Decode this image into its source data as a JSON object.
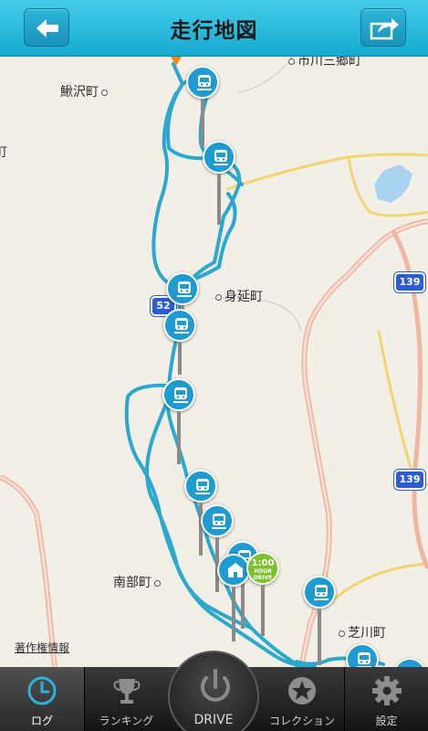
{
  "header": {
    "title": "走行地図"
  },
  "map": {
    "places": {
      "kajikazawa": "鰍沢町",
      "minobu": "身延町",
      "nanbu": "南部町",
      "shibakawa": "芝川町",
      "top_right": "市川三郷町",
      "left_edge": "町"
    },
    "route_shields": [
      "139",
      "139",
      "52"
    ],
    "copyright": "著作権情報",
    "goal_pin_text": [
      "1:00",
      "HOUR",
      "DRIVE"
    ]
  },
  "tabbar": {
    "tabs": [
      {
        "label": "ログ",
        "icon": "clock-icon",
        "active": true
      },
      {
        "label": "ランキング",
        "icon": "trophy-icon"
      },
      {
        "label": "DRIVE",
        "icon": "power-icon"
      },
      {
        "label": "コレクション",
        "icon": "star-icon"
      },
      {
        "label": "設定",
        "icon": "gear-icon"
      }
    ]
  },
  "colors": {
    "accent": "#1e9bd0",
    "route": "#2aa8cf",
    "header": "#2bbde0",
    "goal": "#7cc12b"
  }
}
